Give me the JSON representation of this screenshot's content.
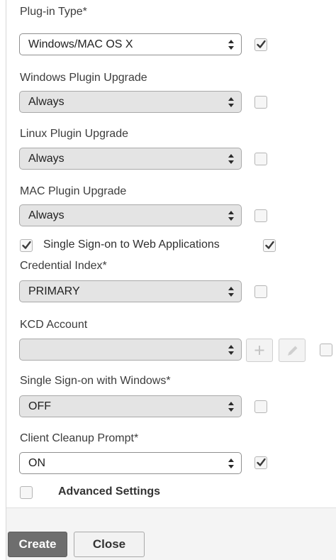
{
  "form": {
    "plugin_type": {
      "label": "Plug-in Type*",
      "value": "Windows/MAC OS X",
      "override_checked": true
    },
    "windows_plugin_upgrade": {
      "label": "Windows Plugin Upgrade",
      "value": "Always",
      "override_checked": false
    },
    "linux_plugin_upgrade": {
      "label": "Linux Plugin Upgrade",
      "value": "Always",
      "override_checked": false
    },
    "mac_plugin_upgrade": {
      "label": "MAC Plugin Upgrade",
      "value": "Always",
      "override_checked": false
    },
    "sso_web_apps": {
      "label": "Single Sign-on to Web Applications",
      "checked": true,
      "override_checked": true
    },
    "credential_index": {
      "label": "Credential Index*",
      "value": "PRIMARY",
      "override_checked": false
    },
    "kcd_account": {
      "label": "KCD Account",
      "value": "",
      "add_icon": "plus-icon",
      "edit_icon": "pencil-icon",
      "override_checked": false
    },
    "sso_windows": {
      "label": "Single Sign-on with Windows*",
      "value": "OFF",
      "override_checked": false
    },
    "client_cleanup_prompt": {
      "label": "Client Cleanup Prompt*",
      "value": "ON",
      "override_checked": true
    },
    "advanced_settings": {
      "label": "Advanced Settings",
      "checked": false
    }
  },
  "footer": {
    "create_label": "Create",
    "close_label": "Close"
  },
  "colors": {
    "checkmark": "#3a3a3a",
    "disabled_select_bg": "#e4e4e4",
    "create_button_bg": "#6e6e6e"
  }
}
